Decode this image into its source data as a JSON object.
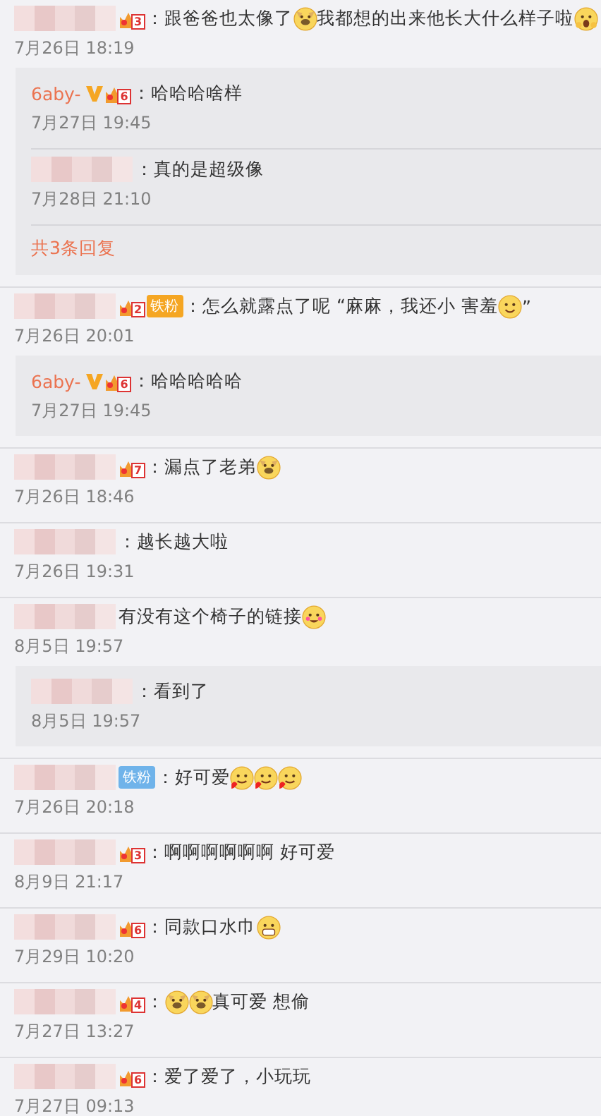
{
  "comments": [
    {
      "author": {
        "blurred": true,
        "level": "3"
      },
      "parts": [
        {
          "kind": "text",
          "text": "：跟爸爸也太像了"
        },
        {
          "kind": "dog"
        },
        {
          "kind": "text",
          "text": "我都想的出来他长大什么样子啦"
        },
        {
          "kind": "shocked"
        }
      ],
      "date": "7月26日 18:19",
      "replies": [
        {
          "author": {
            "name": "6aby-",
            "verified": true,
            "level": "6"
          },
          "parts": [
            {
              "kind": "text",
              "text": "：哈哈哈啥样"
            }
          ],
          "date": "7月27日 19:45"
        },
        {
          "author": {
            "blurred": true
          },
          "parts": [
            {
              "kind": "text",
              "text": "：真的是超级像"
            }
          ],
          "date": "7月28日 21:10"
        }
      ],
      "more": "共3条回复"
    },
    {
      "author": {
        "blurred": true,
        "level": "2",
        "fan": {
          "text": "铁粉",
          "color": "#f5a623"
        }
      },
      "parts": [
        {
          "kind": "text",
          "text": "：怎么就露点了呢 “麻麻，我还小 害羞"
        },
        {
          "kind": "smile"
        },
        {
          "kind": "text",
          "text": "”"
        }
      ],
      "date": "7月26日 20:01",
      "replies": [
        {
          "author": {
            "name": "6aby-",
            "verified": true,
            "level": "6"
          },
          "parts": [
            {
              "kind": "text",
              "text": "：哈哈哈哈哈"
            }
          ],
          "date": "7月27日 19:45"
        }
      ]
    },
    {
      "author": {
        "blurred": true,
        "level": "7"
      },
      "parts": [
        {
          "kind": "text",
          "text": "：漏点了老弟"
        },
        {
          "kind": "dog"
        }
      ],
      "date": "7月26日 18:46"
    },
    {
      "author": {
        "blurred": true
      },
      "parts": [
        {
          "kind": "text",
          "text": "：越长越大啦"
        }
      ],
      "date": "7月26日 19:31"
    },
    {
      "author": {
        "blurred": true
      },
      "parts": [
        {
          "kind": "text",
          "text": "有没有这个椅子的链接"
        },
        {
          "kind": "blush"
        }
      ],
      "date": "8月5日 19:57",
      "replies": [
        {
          "author": {
            "blurred": true
          },
          "parts": [
            {
              "kind": "text",
              "text": "：看到了"
            }
          ],
          "date": "8月5日 19:57"
        }
      ]
    },
    {
      "author": {
        "blurred": true,
        "fan": {
          "text": "铁粉",
          "color": "#6fb3ea"
        }
      },
      "parts": [
        {
          "kind": "text",
          "text": "：好可爱"
        },
        {
          "kind": "love"
        },
        {
          "kind": "love"
        },
        {
          "kind": "love"
        }
      ],
      "date": "7月26日 20:18"
    },
    {
      "author": {
        "blurred": true,
        "level": "3"
      },
      "parts": [
        {
          "kind": "text",
          "text": "：啊啊啊啊啊啊 好可爱"
        }
      ],
      "date": "8月9日 21:17"
    },
    {
      "author": {
        "blurred": true,
        "level": "6"
      },
      "parts": [
        {
          "kind": "text",
          "text": "：同款口水巾"
        },
        {
          "kind": "grin"
        }
      ],
      "date": "7月29日 10:20"
    },
    {
      "author": {
        "blurred": true,
        "level": "4"
      },
      "parts": [
        {
          "kind": "text",
          "text": "："
        },
        {
          "kind": "dog"
        },
        {
          "kind": "dog"
        },
        {
          "kind": "text",
          "text": "真可爱 想偷"
        }
      ],
      "date": "7月27日 13:27"
    },
    {
      "author": {
        "blurred": true,
        "level": "6"
      },
      "parts": [
        {
          "kind": "text",
          "text": "：爱了爱了，小玩玩"
        }
      ],
      "date": "7月27日 09:13"
    }
  ]
}
